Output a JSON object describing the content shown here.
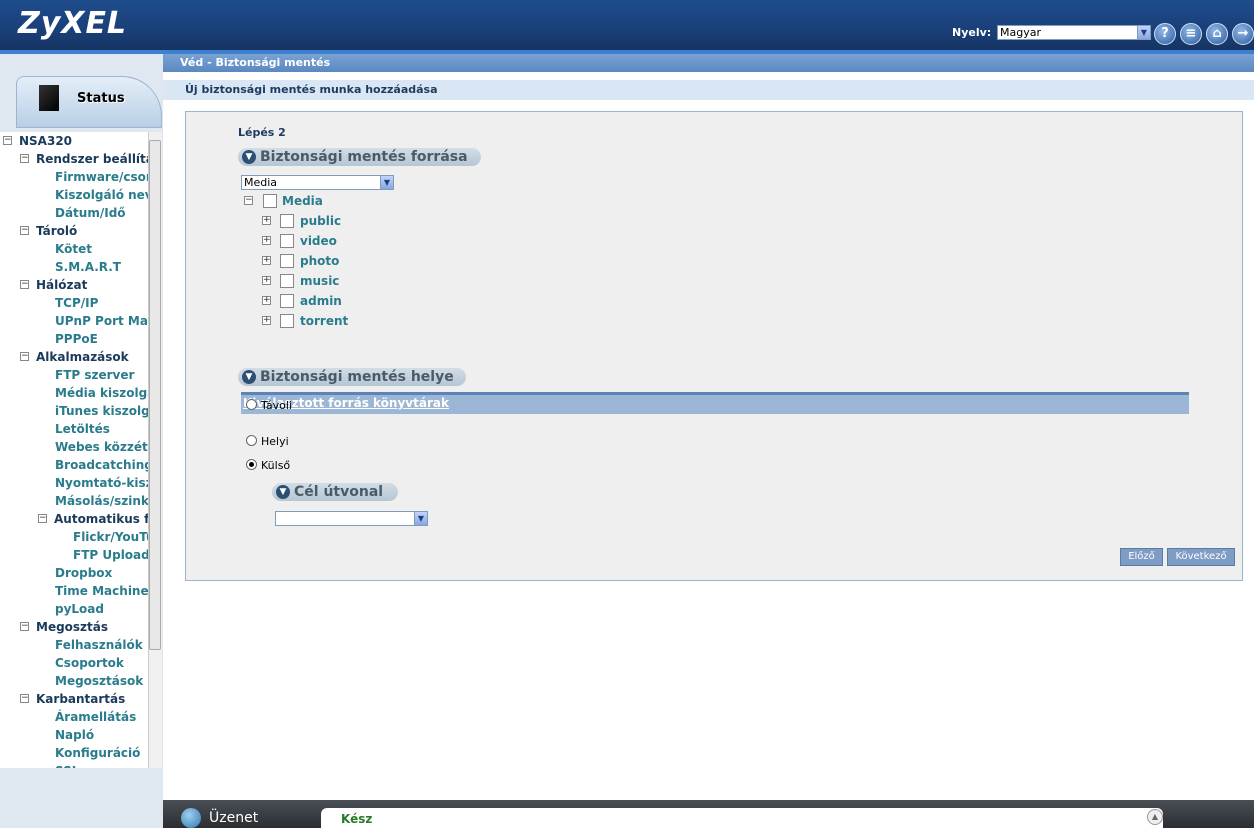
{
  "header": {
    "logo": "ZyXEL",
    "lang_label": "Nyelv:",
    "lang_value": "Magyar"
  },
  "left": {
    "status_label": "Status",
    "tree": [
      {
        "label": "NSA320",
        "level": 0,
        "pm": "−"
      },
      {
        "label": "Rendszer beállítás",
        "level": 1,
        "pm": "−"
      },
      {
        "label": "Firmware/csomag",
        "level": 2
      },
      {
        "label": "Kiszolgáló neve",
        "level": 2
      },
      {
        "label": "Dátum/Idő",
        "level": 2
      },
      {
        "label": "Tároló",
        "level": 1,
        "pm": "−"
      },
      {
        "label": "Kötet",
        "level": 2
      },
      {
        "label": "S.M.A.R.T",
        "level": 2
      },
      {
        "label": "Hálózat",
        "level": 1,
        "pm": "−"
      },
      {
        "label": "TCP/IP",
        "level": 2
      },
      {
        "label": "UPnP Port Mapping",
        "level": 2
      },
      {
        "label": "PPPoE",
        "level": 2
      },
      {
        "label": "Alkalmazások",
        "level": 1,
        "pm": "−"
      },
      {
        "label": "FTP szerver",
        "level": 2
      },
      {
        "label": "Média kiszolgáló",
        "level": 2
      },
      {
        "label": "iTunes kiszolgáló",
        "level": 2
      },
      {
        "label": "Letöltés",
        "level": 2
      },
      {
        "label": "Webes közzététel",
        "level": 2
      },
      {
        "label": "Broadcatching",
        "level": 2
      },
      {
        "label": "Nyomtató-kiszolgáló",
        "level": 2
      },
      {
        "label": "Másolás/szinkronizálás",
        "level": 2
      },
      {
        "label": "Automatikus feltöltés",
        "level": 2,
        "pm": "−",
        "dark": true
      },
      {
        "label": "Flickr/YouTube",
        "level": 3
      },
      {
        "label": "FTP Uploadr",
        "level": 3
      },
      {
        "label": "Dropbox",
        "level": 2
      },
      {
        "label": "Time Machine",
        "level": 2
      },
      {
        "label": "pyLoad",
        "level": 2
      },
      {
        "label": "Megosztás",
        "level": 1,
        "pm": "−"
      },
      {
        "label": "Felhasználók",
        "level": 2
      },
      {
        "label": "Csoportok",
        "level": 2
      },
      {
        "label": "Megosztások",
        "level": 2
      },
      {
        "label": "Karbantartás",
        "level": 1,
        "pm": "−"
      },
      {
        "label": "Áramellátás",
        "level": 2
      },
      {
        "label": "Napló",
        "level": 2
      },
      {
        "label": "Konfiguráció",
        "level": 2
      },
      {
        "label": "SSL",
        "level": 2
      }
    ]
  },
  "main": {
    "breadcrumb": "Véd - Biztonsági mentés",
    "subheader": "Új biztonsági mentés munka hozzáadása",
    "step": "Lépés 2",
    "source_title": "Biztonsági mentés forrása",
    "source_select": "Media",
    "root_folder": "Media",
    "folders": [
      "public",
      "video",
      "photo",
      "music",
      "admin",
      "torrent"
    ],
    "selected_bar": "Kiválasztott forrás könyvtárak",
    "dest_title": "Biztonsági mentés helye",
    "opt_remote": "Távoli",
    "opt_local": "Helyi",
    "opt_external": "Külső",
    "target_title": "Cél útvonal",
    "target_select": "",
    "prev_btn": "Előző",
    "next_btn": "Következő"
  },
  "footer": {
    "message_label": "Üzenet",
    "status_text": "Kész"
  }
}
